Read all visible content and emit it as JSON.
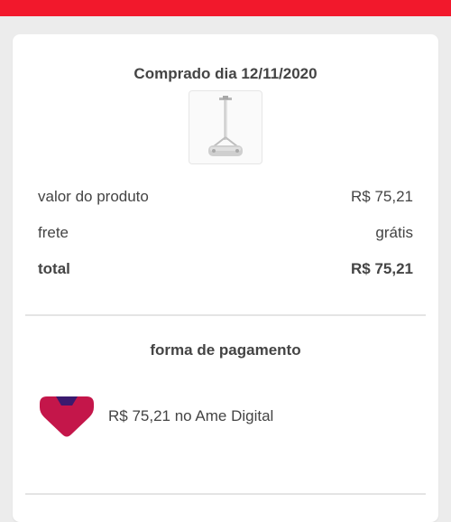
{
  "header": {
    "bar_color": "#f2182c"
  },
  "order": {
    "purchase_date": "Comprado dia 12/11/2020",
    "product_image_icon": "ceiling-projector-mount-icon"
  },
  "summary": {
    "product_value_label": "valor do produto",
    "product_value": "R$ 75,21",
    "shipping_label": "frete",
    "shipping_value": "grátis",
    "total_label": "total",
    "total_value": "R$ 75,21"
  },
  "payment": {
    "title": "forma de pagamento",
    "method_icon": "ame-digital-logo-icon",
    "method_text": "R$ 75,21 no Ame Digital",
    "brand_colors": [
      "#c4164a",
      "#3a1a6e"
    ]
  }
}
